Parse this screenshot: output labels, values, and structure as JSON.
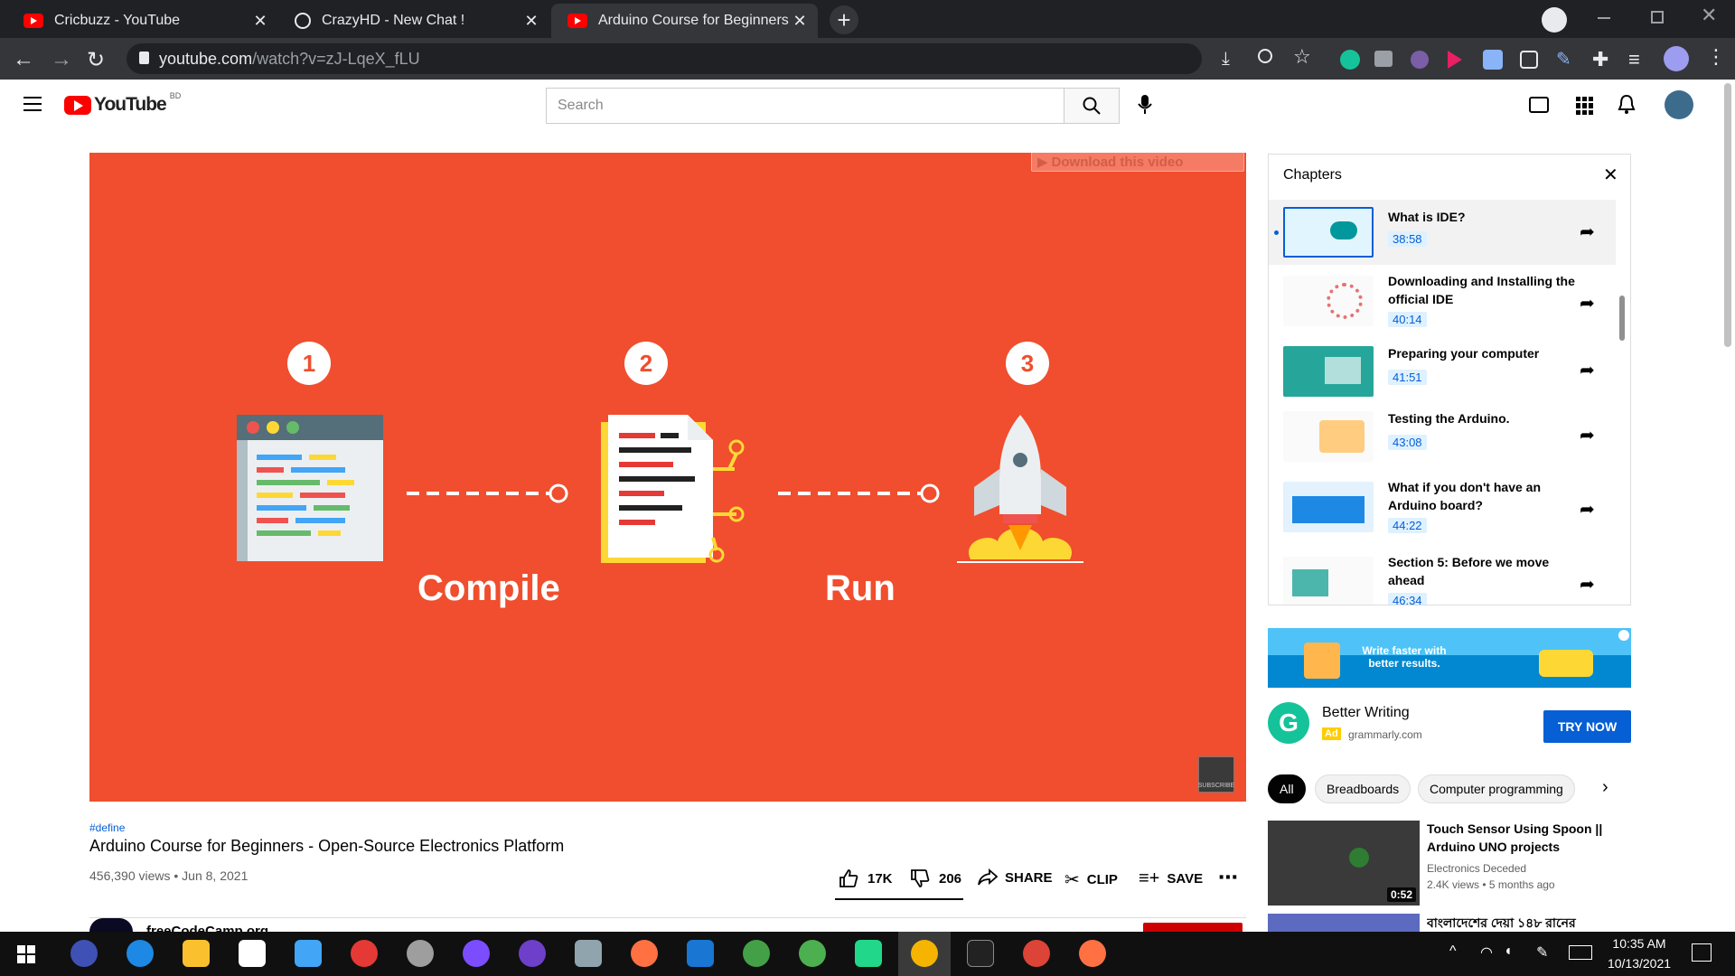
{
  "browser": {
    "tabs": [
      {
        "title": "Cricbuzz - YouTube",
        "close": "✕"
      },
      {
        "title": "CrazyHD - New Chat !",
        "close": "✕"
      },
      {
        "title": "Arduino Course for Beginners - C",
        "close": "✕"
      }
    ],
    "new_tab": "+",
    "url_main": "youtube.com",
    "url_path": "/watch?v=zJ-LqeX_fLU"
  },
  "youtube": {
    "logo": "YouTube",
    "region": "BD",
    "search_placeholder": "Search"
  },
  "video": {
    "overlay_download": "Download this video",
    "steps": [
      "1",
      "2",
      "3"
    ],
    "labels": [
      "Compile",
      "Run"
    ],
    "subscribe_badge": "SUBSCRIBE"
  },
  "info": {
    "hashtag": "#define",
    "title": "Arduino Course for Beginners - Open-Source Electronics Platform",
    "views_date": "456,390 views • Jun 8, 2021",
    "likes": "17K",
    "dislikes": "206",
    "share": "SHARE",
    "clip": "CLIP",
    "save": "SAVE",
    "channel_partial": "freeCodeCamp.org"
  },
  "chapters": {
    "heading": "Chapters",
    "items": [
      {
        "title": "What is IDE?",
        "time": "38:58"
      },
      {
        "title": "Downloading and Installing the official IDE",
        "time": "40:14"
      },
      {
        "title": "Preparing your computer",
        "time": "41:51"
      },
      {
        "title": "Testing the Arduino.",
        "time": "43:08"
      },
      {
        "title": "What if you don't have an Arduino board?",
        "time": "44:22"
      },
      {
        "title": "Section 5: Before we move ahead",
        "time": "46:34"
      }
    ]
  },
  "ad": {
    "banner_text": "Write faster with better results.",
    "title": "Better Writing",
    "badge": "Ad",
    "domain": "grammarly.com",
    "cta": "TRY NOW"
  },
  "chips": [
    "All",
    "Breadboards",
    "Computer programming"
  ],
  "recommendation": {
    "title": "Touch Sensor Using Spoon || Arduino UNO projects",
    "channel": "Electronics Deceded",
    "meta": "2.4K views • 5 months ago",
    "duration": "0:52",
    "next_title_partial": "বাংলাদেশের দেয়া ১৪৮ রানের"
  },
  "taskbar": {
    "time": "10:35 AM",
    "date": "10/13/2021"
  },
  "colors": {
    "video_bg": "#f04e2e",
    "yt_red": "#ff0000",
    "link_blue": "#065fd4",
    "cta_blue": "#065fd4"
  }
}
